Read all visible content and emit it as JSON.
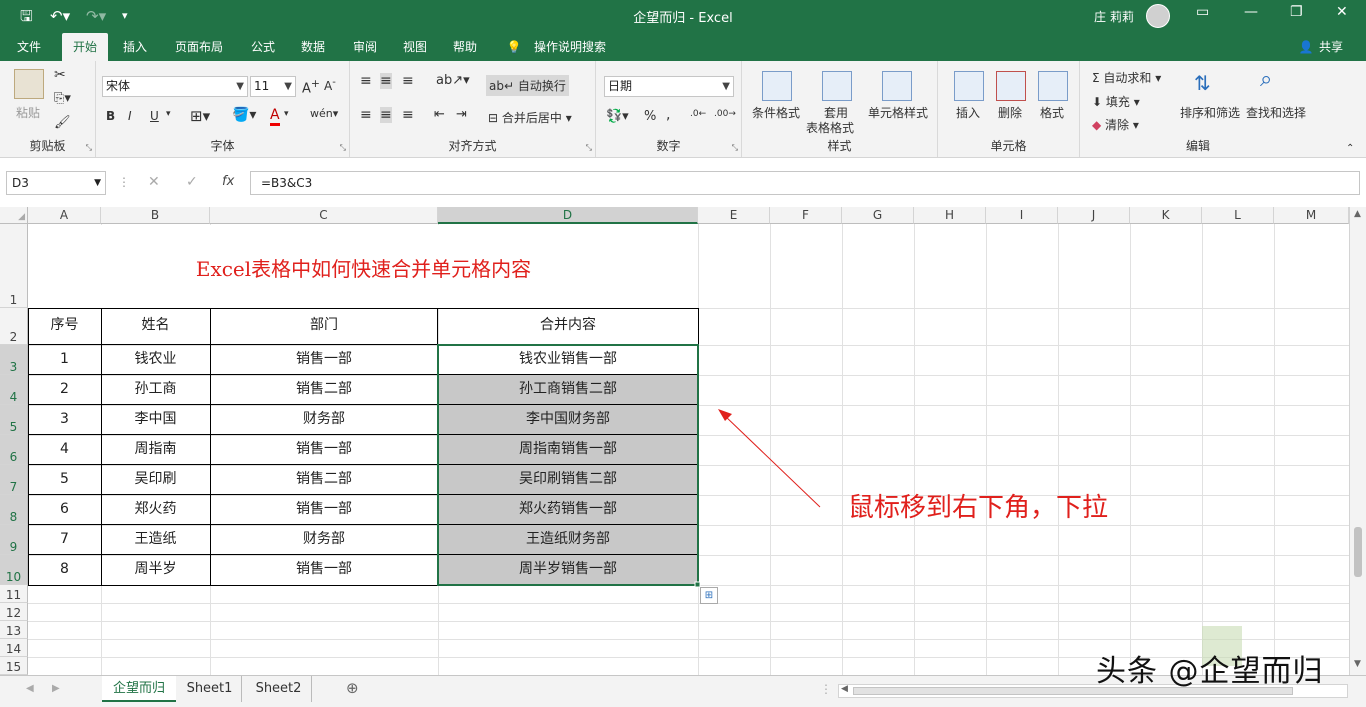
{
  "app": {
    "title": "企望而归  -  Excel",
    "user": "庄 莉莉",
    "share": "共享"
  },
  "tabs": [
    "文件",
    "开始",
    "插入",
    "页面布局",
    "公式",
    "数据",
    "审阅",
    "视图",
    "帮助",
    "操作说明搜索"
  ],
  "ribbon": {
    "clipboard": {
      "paste": "粘贴",
      "label": "剪贴板"
    },
    "font": {
      "name": "宋体",
      "size": "11",
      "bold": "B",
      "italic": "I",
      "underline": "U",
      "label": "字体"
    },
    "alignment": {
      "wrap": "自动换行",
      "merge": "合并后居中",
      "label": "对齐方式"
    },
    "number": {
      "format": "日期",
      "percent": "%",
      "label": "数字"
    },
    "styles": {
      "conditional": "条件格式",
      "table_line1": "套用",
      "table_line2": "表格格式",
      "cell_styles": "单元格样式",
      "label": "样式"
    },
    "cells": {
      "insert": "插入",
      "delete": "删除",
      "format": "格式",
      "label": "单元格"
    },
    "editing": {
      "autosum": "自动求和",
      "fill": "填充",
      "clear": "清除",
      "sort": "排序和筛选",
      "find": "查找和选择",
      "label": "编辑"
    }
  },
  "formula_bar": {
    "namebox": "D3",
    "fx": "fx",
    "formula": "=B3&C3"
  },
  "columns": [
    "A",
    "B",
    "C",
    "D",
    "E",
    "F",
    "G",
    "H",
    "I",
    "J",
    "K",
    "L",
    "M"
  ],
  "rows": [
    "1",
    "2",
    "3",
    "4",
    "5",
    "6",
    "7",
    "8",
    "9",
    "10",
    "11",
    "12",
    "13",
    "14",
    "15"
  ],
  "sheet": {
    "title": "Excel表格中如何快速合并单元格内容",
    "headers": [
      "序号",
      "姓名",
      "部门",
      "合并内容"
    ],
    "data": [
      [
        "1",
        "钱农业",
        "销售一部",
        "钱农业销售一部"
      ],
      [
        "2",
        "孙工商",
        "销售二部",
        "孙工商销售二部"
      ],
      [
        "3",
        "李中国",
        "财务部",
        "李中国财务部"
      ],
      [
        "4",
        "周指南",
        "销售一部",
        "周指南销售一部"
      ],
      [
        "5",
        "吴印刷",
        "销售二部",
        "吴印刷销售二部"
      ],
      [
        "6",
        "郑火药",
        "销售一部",
        "郑火药销售一部"
      ],
      [
        "7",
        "王造纸",
        "财务部",
        "王造纸财务部"
      ],
      [
        "8",
        "周半岁",
        "销售一部",
        "周半岁销售一部"
      ]
    ],
    "annotation": "鼠标移到右下角，下拉"
  },
  "sheet_tabs": [
    "企望而归",
    "Sheet1",
    "Sheet2"
  ],
  "watermark": "头条 @企望而归",
  "colors": {
    "excel_green": "#217346",
    "annotation_red": "#e0201c",
    "selection_gray": "#c8c8c8"
  }
}
